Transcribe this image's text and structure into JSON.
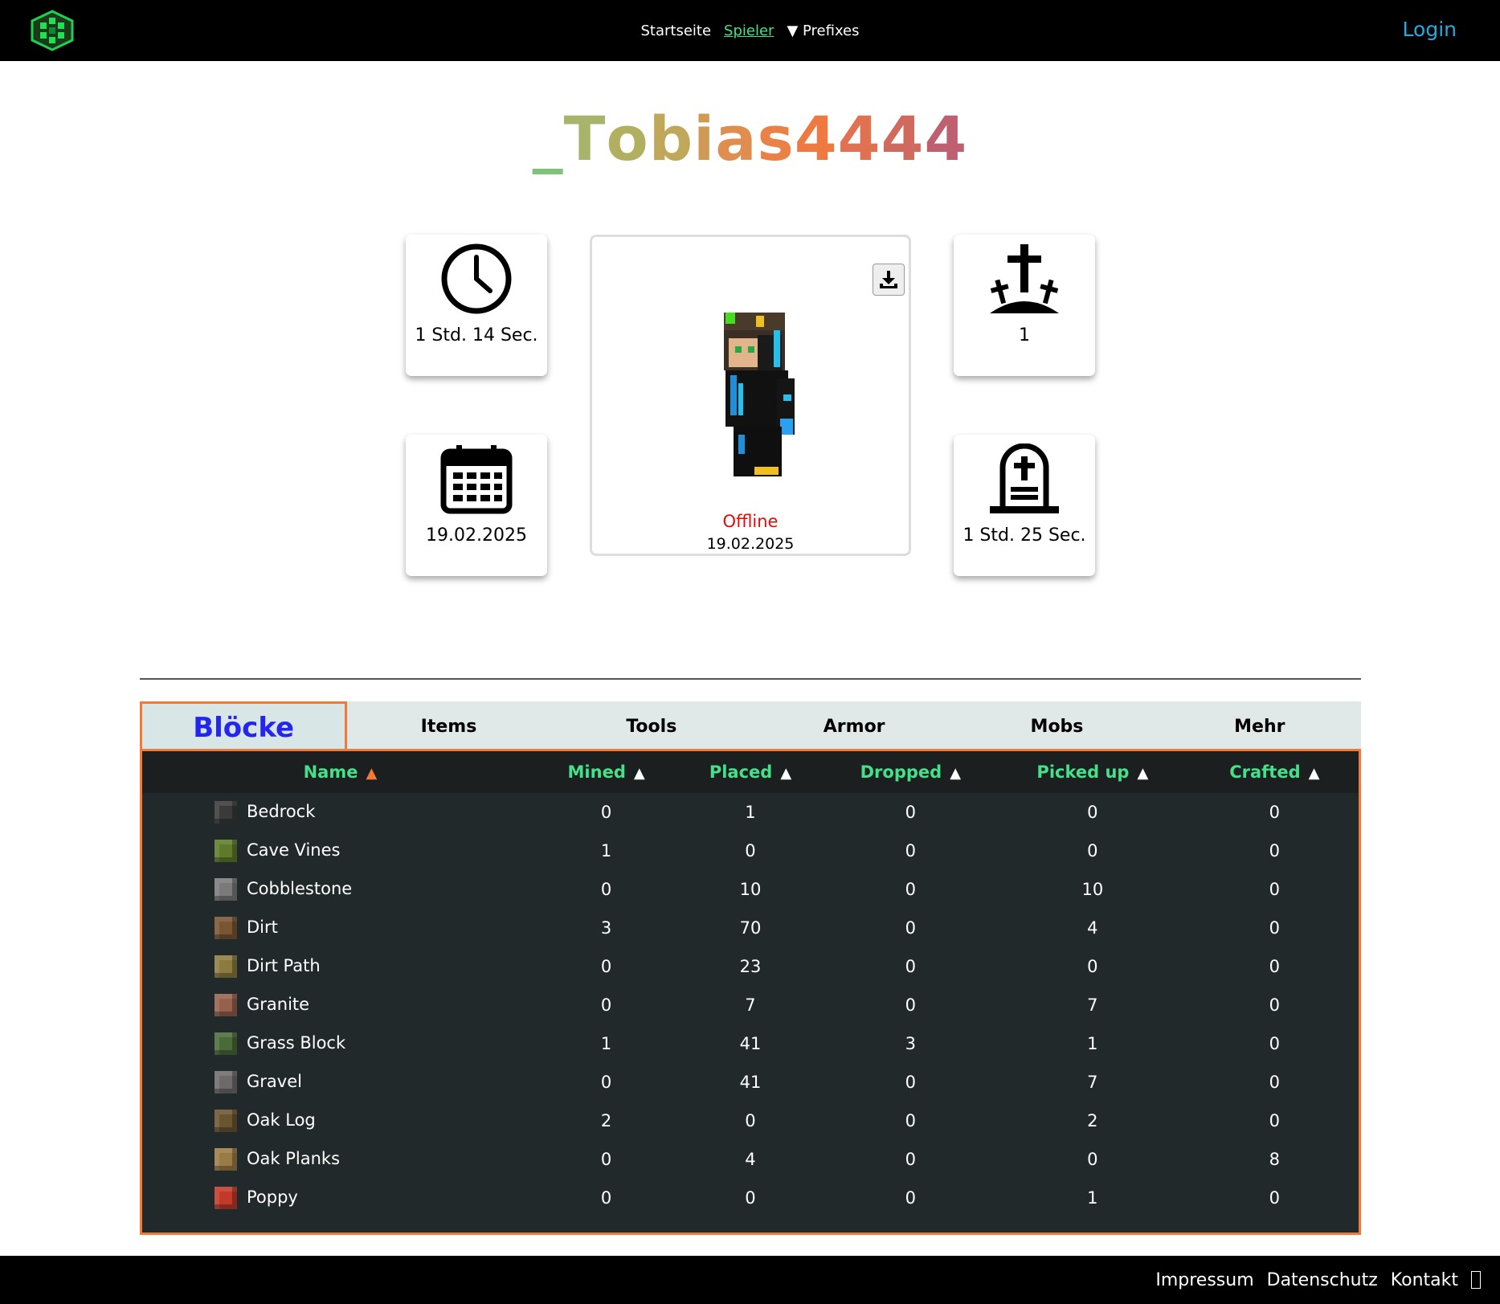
{
  "nav": {
    "home": "Startseite",
    "players": "Spieler",
    "prefixes": "▼ Prefixes",
    "login": "Login"
  },
  "player": {
    "name_parts": [
      {
        "text": "_",
        "color": "#7fc27a"
      },
      {
        "text": "T",
        "color": "#a8b46a"
      },
      {
        "text": "o",
        "color": "#b0b060"
      },
      {
        "text": "b",
        "color": "#c0a85a"
      },
      {
        "text": "i",
        "color": "#d09a55"
      },
      {
        "text": "a",
        "color": "#e08d50"
      },
      {
        "text": "s",
        "color": "#ea8248"
      },
      {
        "text": "4",
        "color": "#ee7a42"
      },
      {
        "text": "4",
        "color": "#e07252"
      },
      {
        "text": "4",
        "color": "#d06a5e"
      },
      {
        "text": "4",
        "color": "#bf6070"
      }
    ],
    "status": "Offline",
    "status_date": "19.02.2025"
  },
  "stats": {
    "playtime": "1 Std. 14 Sec.",
    "first_join": "19.02.2025",
    "deaths": "1",
    "since_death": "1 Std. 25 Sec."
  },
  "tabs": [
    "Blöcke",
    "Items",
    "Tools",
    "Armor",
    "Mobs",
    "Mehr"
  ],
  "table": {
    "headers": [
      "Name",
      "Mined",
      "Placed",
      "Dropped",
      "Picked up",
      "Crafted"
    ],
    "rows": [
      {
        "name": "Bedrock",
        "color": "#3a3a3a",
        "vals": [
          "0",
          "1",
          "0",
          "0",
          "0"
        ]
      },
      {
        "name": "Cave Vines",
        "color": "#5e7a2a",
        "vals": [
          "1",
          "0",
          "0",
          "0",
          "0"
        ]
      },
      {
        "name": "Cobblestone",
        "color": "#7a7a7a",
        "vals": [
          "0",
          "10",
          "0",
          "10",
          "0"
        ]
      },
      {
        "name": "Dirt",
        "color": "#7a5533",
        "vals": [
          "3",
          "70",
          "0",
          "4",
          "0"
        ]
      },
      {
        "name": "Dirt Path",
        "color": "#8c7a3e",
        "vals": [
          "0",
          "23",
          "0",
          "0",
          "0"
        ]
      },
      {
        "name": "Granite",
        "color": "#95614d",
        "vals": [
          "0",
          "7",
          "0",
          "7",
          "0"
        ]
      },
      {
        "name": "Grass Block",
        "color": "#4a6a38",
        "vals": [
          "1",
          "41",
          "3",
          "1",
          "0"
        ]
      },
      {
        "name": "Gravel",
        "color": "#6e6a6a",
        "vals": [
          "0",
          "41",
          "0",
          "7",
          "0"
        ]
      },
      {
        "name": "Oak Log",
        "color": "#6b5531",
        "vals": [
          "2",
          "0",
          "0",
          "2",
          "0"
        ]
      },
      {
        "name": "Oak Planks",
        "color": "#9b7b45",
        "vals": [
          "0",
          "4",
          "0",
          "0",
          "8"
        ]
      },
      {
        "name": "Poppy",
        "color": "#c23a2a",
        "vals": [
          "0",
          "0",
          "0",
          "1",
          "0"
        ]
      }
    ]
  },
  "footer": [
    "Impressum",
    "Datenschutz",
    "Kontakt"
  ]
}
